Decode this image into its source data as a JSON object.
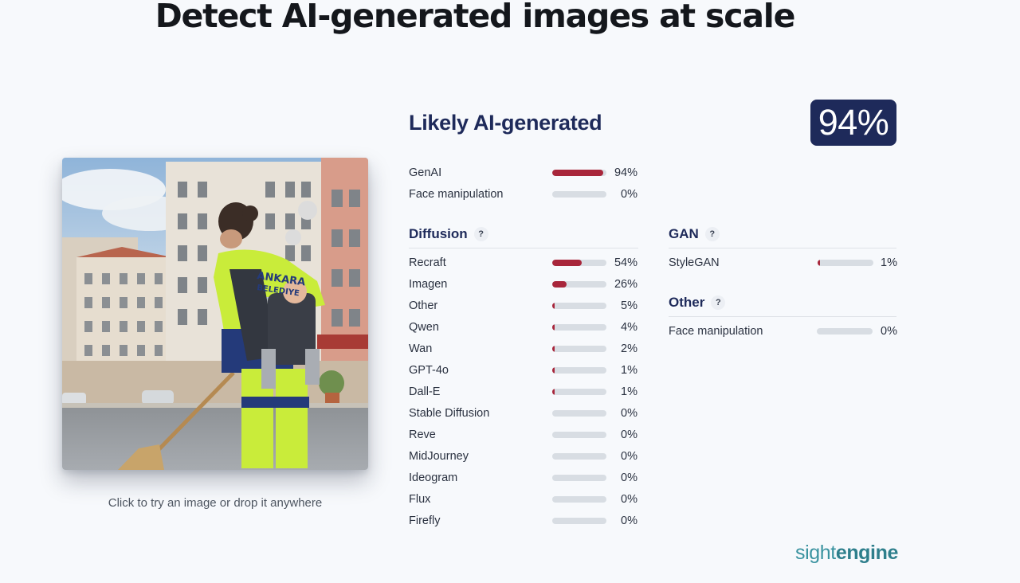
{
  "headline": "Detect AI-generated images at scale",
  "image_hint": "Click to try an image or drop it anywhere",
  "verdict": {
    "title": "Likely AI-generated",
    "score": "94%"
  },
  "colors": {
    "accent": "#1e2a5a",
    "bar_fill": "#a8263b",
    "bar_track": "#d8dde3"
  },
  "top_scores": [
    {
      "label": "GenAI",
      "value": 94,
      "text": "94%"
    },
    {
      "label": "Face manipulation",
      "value": 0,
      "text": "0%"
    }
  ],
  "diffusion": {
    "title": "Diffusion",
    "help": "?",
    "items": [
      {
        "label": "Recraft",
        "value": 54,
        "text": "54%"
      },
      {
        "label": "Imagen",
        "value": 26,
        "text": "26%"
      },
      {
        "label": "Other",
        "value": 5,
        "text": "5%"
      },
      {
        "label": "Qwen",
        "value": 4,
        "text": "4%"
      },
      {
        "label": "Wan",
        "value": 2,
        "text": "2%"
      },
      {
        "label": "GPT-4o",
        "value": 1,
        "text": "1%"
      },
      {
        "label": "Dall-E",
        "value": 1,
        "text": "1%"
      },
      {
        "label": "Stable Diffusion",
        "value": 0,
        "text": "0%"
      },
      {
        "label": "Reve",
        "value": 0,
        "text": "0%"
      },
      {
        "label": "MidJourney",
        "value": 0,
        "text": "0%"
      },
      {
        "label": "Ideogram",
        "value": 0,
        "text": "0%"
      },
      {
        "label": "Flux",
        "value": 0,
        "text": "0%"
      },
      {
        "label": "Firefly",
        "value": 0,
        "text": "0%"
      }
    ]
  },
  "gan": {
    "title": "GAN",
    "help": "?",
    "items": [
      {
        "label": "StyleGAN",
        "value": 1,
        "text": "1%"
      }
    ]
  },
  "other": {
    "title": "Other",
    "help": "?",
    "items": [
      {
        "label": "Face manipulation",
        "value": 0,
        "text": "0%"
      }
    ]
  },
  "brand": {
    "part1": "sight",
    "part2": "engine"
  },
  "image_text": {
    "line1": "ANKARA",
    "line2": "BELEDIYE"
  }
}
